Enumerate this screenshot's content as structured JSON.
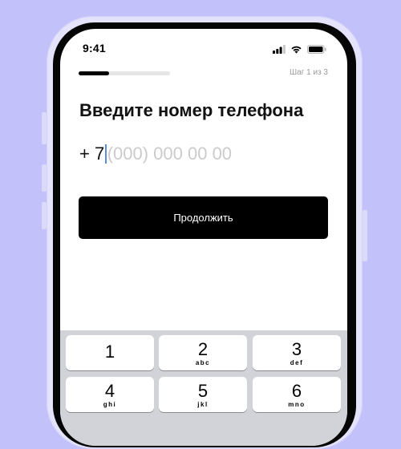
{
  "status_bar": {
    "time": "9:41",
    "icons": [
      "signal-icon",
      "wifi-icon",
      "battery-icon"
    ]
  },
  "progress": {
    "fraction": 0.33,
    "step_label": "Шаг 1 из 3"
  },
  "title": "Введите номер телефона",
  "phone": {
    "country_code": "+ 7",
    "placeholder": "(000) 000 00 00"
  },
  "continue_label": "Продолжить",
  "keyboard": {
    "keys": [
      {
        "digit": "1",
        "letters": ""
      },
      {
        "digit": "2",
        "letters": "abc"
      },
      {
        "digit": "3",
        "letters": "def"
      },
      {
        "digit": "4",
        "letters": "ghi"
      },
      {
        "digit": "5",
        "letters": "jkl"
      },
      {
        "digit": "6",
        "letters": "mno"
      }
    ]
  },
  "colors": {
    "background": "#c3c1fa",
    "button": "#000000",
    "caret": "#5b8fd6",
    "placeholder": "#cbcbcb"
  }
}
